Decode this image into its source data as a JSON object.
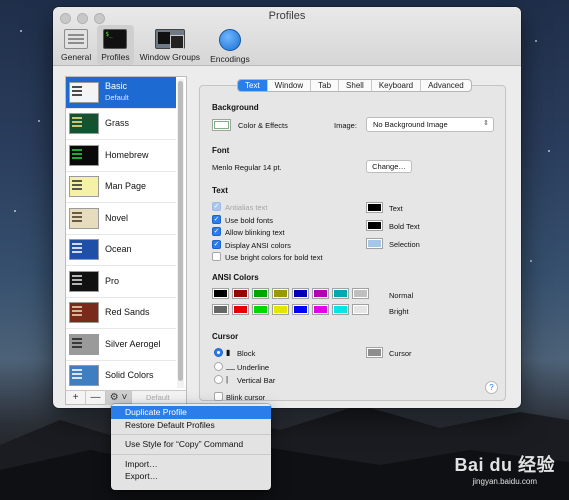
{
  "window": {
    "title": "Profiles"
  },
  "toolbar": {
    "items": [
      {
        "label": "General",
        "active": false,
        "icon": "general-icon"
      },
      {
        "label": "Profiles",
        "active": true,
        "icon": "profiles-icon"
      },
      {
        "label": "Window Groups",
        "active": false,
        "icon": "window-groups-icon"
      },
      {
        "label": "Encodings",
        "active": false,
        "icon": "encodings-globe-icon"
      }
    ]
  },
  "profiles": {
    "items": [
      {
        "name": "Basic",
        "sub": "Default",
        "bg": "#f4f4f4",
        "fg": "#222222",
        "selected": true
      },
      {
        "name": "Grass",
        "sub": "",
        "bg": "#14532f",
        "fg": "#f5e38c",
        "selected": false
      },
      {
        "name": "Homebrew",
        "sub": "",
        "bg": "#0a0a0a",
        "fg": "#27d33e",
        "selected": false
      },
      {
        "name": "Man Page",
        "sub": "",
        "bg": "#f5f1a7",
        "fg": "#333333",
        "selected": false
      },
      {
        "name": "Novel",
        "sub": "",
        "bg": "#e8dcbf",
        "fg": "#4a3a2a",
        "selected": false
      },
      {
        "name": "Ocean",
        "sub": "",
        "bg": "#1f4fa6",
        "fg": "#ffffff",
        "selected": false
      },
      {
        "name": "Pro",
        "sub": "",
        "bg": "#111111",
        "fg": "#dddddd",
        "selected": false
      },
      {
        "name": "Red Sands",
        "sub": "",
        "bg": "#7a2a1a",
        "fg": "#e8d9b3",
        "selected": false
      },
      {
        "name": "Silver Aerogel",
        "sub": "",
        "bg": "#9a9a9a",
        "fg": "#222222",
        "selected": false
      },
      {
        "name": "Solid Colors",
        "sub": "",
        "bg": "#3f7fbf",
        "fg": "#ffffff",
        "selected": false
      }
    ],
    "footer": {
      "add": "+",
      "remove": "—",
      "gear": "⚙ ˅",
      "default_label": "Default"
    }
  },
  "tabs": [
    {
      "label": "Text",
      "active": true
    },
    {
      "label": "Window",
      "active": false
    },
    {
      "label": "Tab",
      "active": false
    },
    {
      "label": "Shell",
      "active": false
    },
    {
      "label": "Keyboard",
      "active": false
    },
    {
      "label": "Advanced",
      "active": false
    }
  ],
  "background": {
    "title": "Background",
    "color_label": "Color & Effects",
    "image_label": "Image:",
    "image_value": "No Background Image"
  },
  "font": {
    "title": "Font",
    "value": "Menlo Regular 14 pt.",
    "change_button": "Change…"
  },
  "text": {
    "title": "Text",
    "options": [
      {
        "label": "Antialias text",
        "checked": true,
        "disabled": true
      },
      {
        "label": "Use bold fonts",
        "checked": true,
        "disabled": false
      },
      {
        "label": "Allow blinking text",
        "checked": true,
        "disabled": false
      },
      {
        "label": "Display ANSI colors",
        "checked": true,
        "disabled": false
      },
      {
        "label": "Use bright colors for bold text",
        "checked": false,
        "disabled": false
      }
    ],
    "colors": [
      {
        "label": "Text",
        "color": "#000000"
      },
      {
        "label": "Bold Text",
        "color": "#000000"
      },
      {
        "label": "Selection",
        "color": "#a4c6e8"
      }
    ]
  },
  "ansi": {
    "title": "ANSI Colors",
    "normal_label": "Normal",
    "bright_label": "Bright",
    "normal": [
      "#000000",
      "#990000",
      "#00a600",
      "#999900",
      "#0000b2",
      "#b200b2",
      "#00a6b2",
      "#bfbfbf"
    ],
    "bright": [
      "#666666",
      "#e50000",
      "#00d900",
      "#e5e500",
      "#0000ff",
      "#e500e5",
      "#00e5e5",
      "#e5e5e5"
    ]
  },
  "cursor": {
    "title": "Cursor",
    "options": [
      {
        "label": "Block",
        "symbol": "▮",
        "selected": true
      },
      {
        "label": "Underline",
        "symbol": "__",
        "selected": false
      },
      {
        "label": "Vertical Bar",
        "symbol": "|",
        "selected": false
      }
    ],
    "blink_label": "Blink cursor",
    "color_label": "Cursor",
    "color": "#8e8e8e",
    "help": "?"
  },
  "context_menu": {
    "group1": [
      "Duplicate Profile",
      "Restore Default Profiles"
    ],
    "group2": [
      "Use Style for “Copy” Command"
    ],
    "group3": [
      "Import…",
      "Export…"
    ]
  },
  "watermark": {
    "logo": "Bai du 经验",
    "url": "jingyan.baidu.com"
  }
}
